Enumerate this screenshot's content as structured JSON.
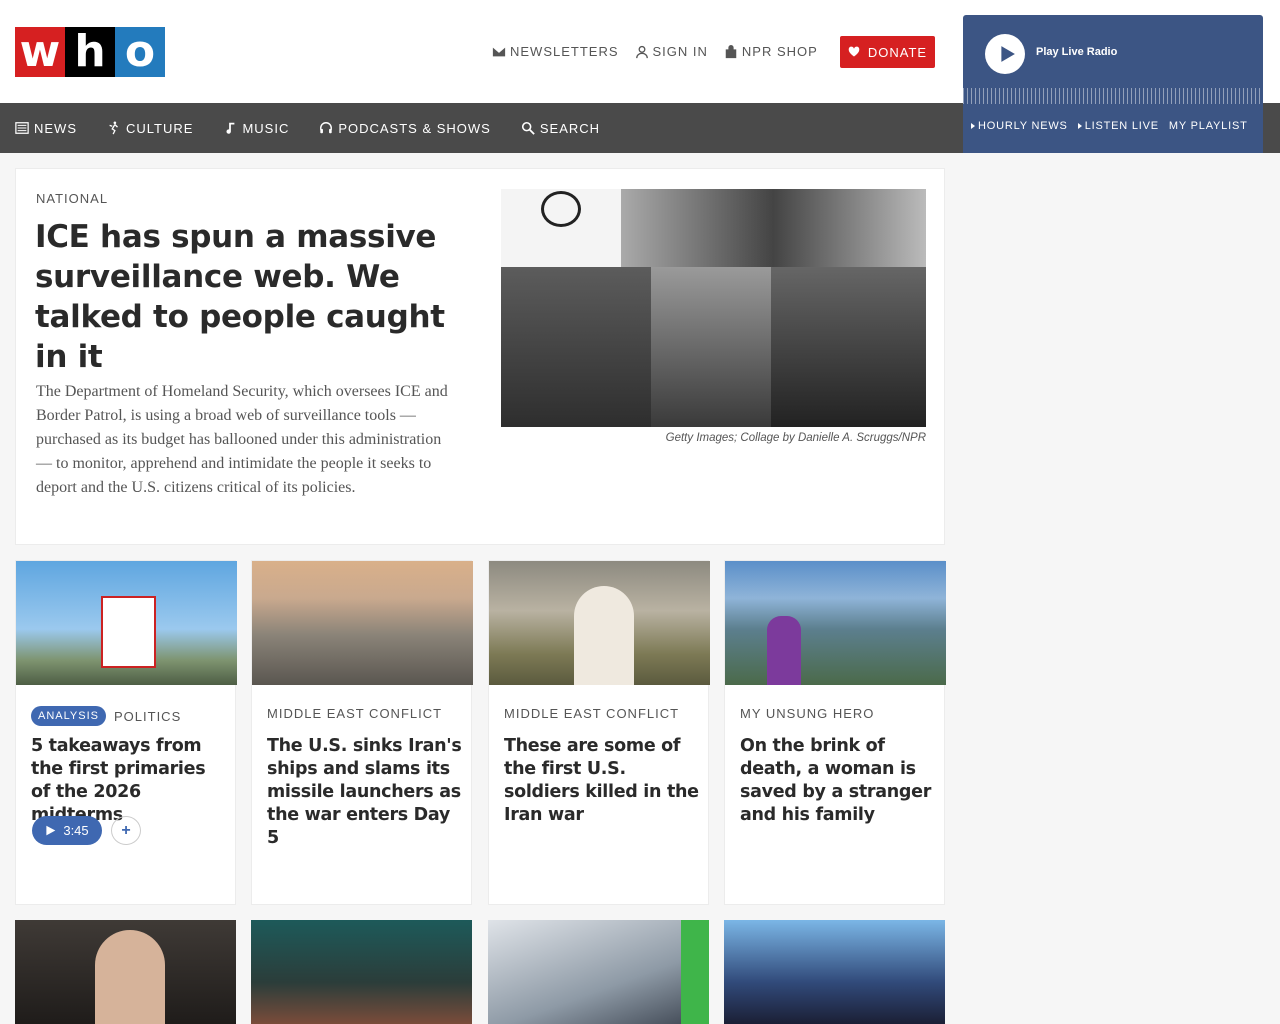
{
  "brand": {
    "letters": [
      "w",
      "h",
      "o"
    ]
  },
  "utility": {
    "newsletters": "NEWSLETTERS",
    "sign_in": "SIGN IN",
    "shop": "NPR SHOP",
    "donate": "DONATE"
  },
  "nav": {
    "news": "NEWS",
    "culture": "CULTURE",
    "music": "MUSIC",
    "podcasts": "PODCASTS & SHOWS",
    "search": "SEARCH"
  },
  "player": {
    "label": "Play Live Radio",
    "hourly": "HOURLY NEWS",
    "listen": "LISTEN LIVE",
    "playlist": "MY PLAYLIST"
  },
  "hero": {
    "slug": "NATIONAL",
    "title": "ICE has spun a massive surveillance web. We talked to people caught in it",
    "teaser": "The Department of Homeland Security, which oversees ICE and Border Patrol, is using a broad web of surveillance tools — purchased as its budget has ballooned under this administration — to monitor, apprehend and intimidate the people it seeks to deport and the U.S. citizens critical of its policies.",
    "credit": "Getty Images; Collage by Danielle A. Scruggs/NPR"
  },
  "cards": [
    {
      "badge": "ANALYSIS",
      "slug": "POLITICS",
      "title": "5 takeaways from the first primaries of the 2026 midterms",
      "duration": "3:45",
      "plus": "+"
    },
    {
      "slug": "MIDDLE EAST CONFLICT",
      "title": "The U.S. sinks Iran's ships and slams its missile launchers as the war enters Day 5"
    },
    {
      "slug": "MIDDLE EAST CONFLICT",
      "title": "These are some of the first U.S. soldiers killed in the Iran war"
    },
    {
      "slug": "MY UNSUNG HERO",
      "title": "On the brink of death, a woman is saved by a stranger and his family"
    }
  ]
}
